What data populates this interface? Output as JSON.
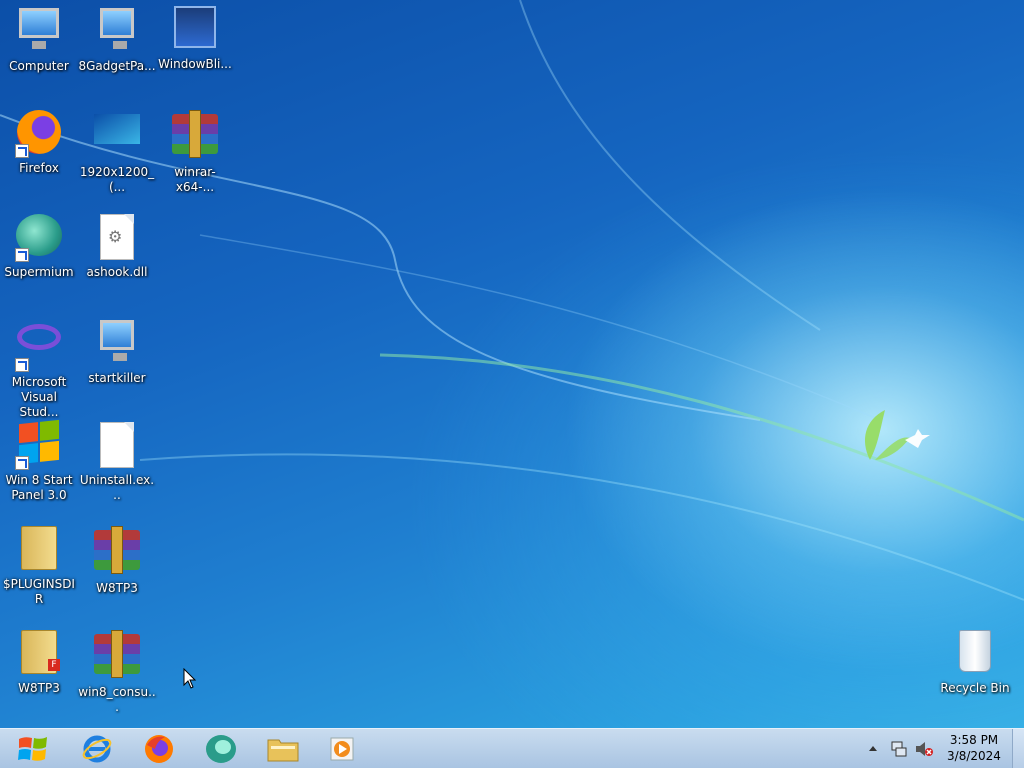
{
  "desktop": {
    "icons": [
      {
        "label": "Computer"
      },
      {
        "label": "8GadgetPa..."
      },
      {
        "label": "WindowBli..."
      },
      {
        "label": "Firefox"
      },
      {
        "label": "1920x1200_(..."
      },
      {
        "label": "winrar-x64-..."
      },
      {
        "label": "Supermium"
      },
      {
        "label": "ashook.dll"
      },
      {
        "label": "Microsoft Visual Stud..."
      },
      {
        "label": "startkiller"
      },
      {
        "label": "Win 8 Start Panel 3.0"
      },
      {
        "label": "Uninstall.ex..."
      },
      {
        "label": "$PLUGINSDIR"
      },
      {
        "label": "W8TP3"
      },
      {
        "label": "W8TP3"
      },
      {
        "label": "win8_consu..."
      },
      {
        "label": "Recycle Bin"
      }
    ]
  },
  "taskbar": {
    "pinned": [
      "start-button",
      "internet-explorer",
      "firefox",
      "supermium",
      "file-explorer",
      "media-player"
    ],
    "clock": {
      "time": "3:58 PM",
      "date": "3/8/2024"
    }
  },
  "colors": {
    "accent": "#1565c0",
    "taskbar": "#b8d0ea"
  }
}
